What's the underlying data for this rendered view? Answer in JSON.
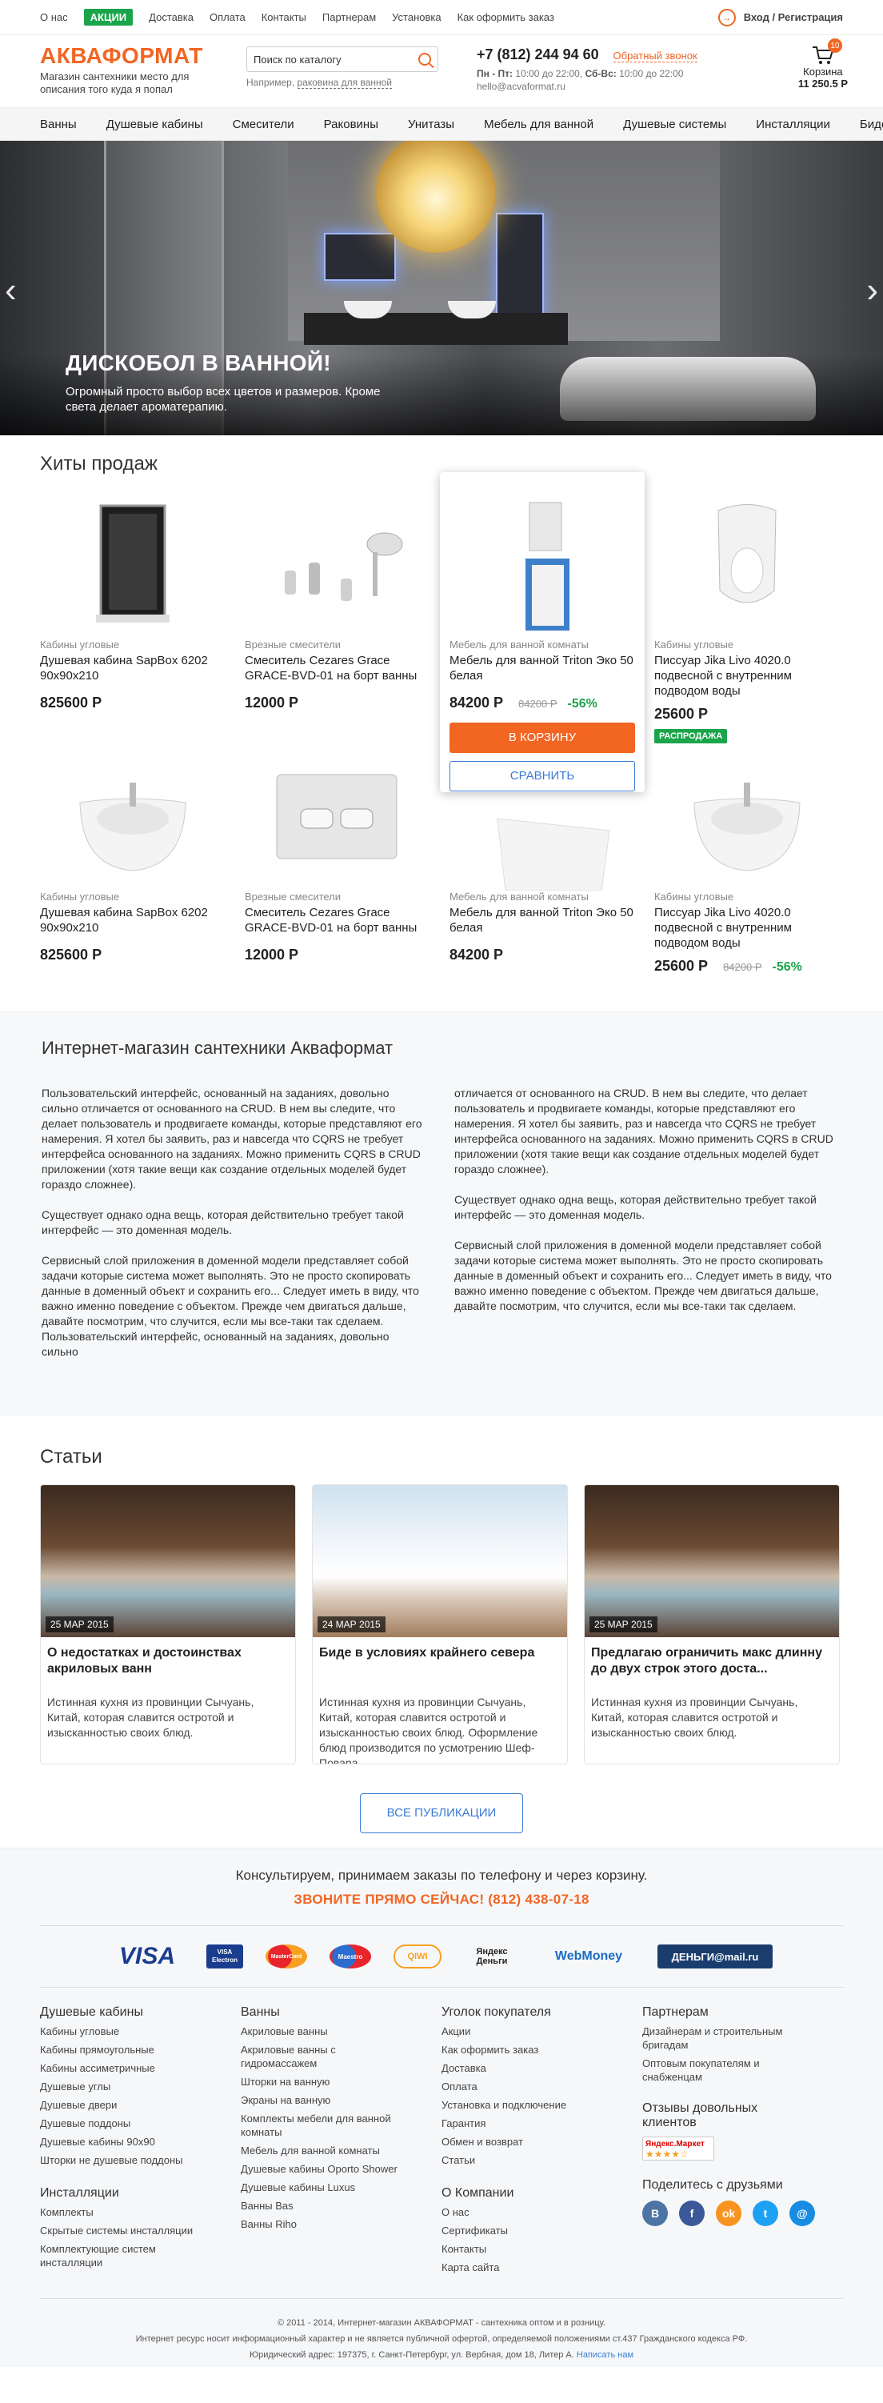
{
  "topbar": {
    "links": [
      "О нас",
      "Доставка",
      "Оплата",
      "Контакты",
      "Партнерам",
      "Установка",
      "Как оформить заказ"
    ],
    "promo": "АКЦИИ",
    "login": "Вход / Регистрация"
  },
  "header": {
    "logo": "АКВАФОРМАТ",
    "tagline": "Магазин сантехники место для описания того куда я попал",
    "search_placeholder": "Поиск по каталогу",
    "search_hint_prefix": "Например,",
    "search_hint_link": "раковина для ванной",
    "phone": "+7 (812) 244 94 60",
    "callback": "Обратный звонок",
    "hours_wd_label": "Пн - Пт:",
    "hours_wd": "10:00 до 22:00,",
    "hours_we_label": "Сб-Вс:",
    "hours_we": "10:00 до 22:00",
    "email": "hello@acvaformat.ru",
    "cart_label": "Корзина",
    "cart_sum": "11 250.5 Р",
    "cart_count": "10"
  },
  "nav": [
    "Ванны",
    "Душевые кабины",
    "Смесители",
    "Раковины",
    "Унитазы",
    "Мебель для ванной",
    "Душевые системы",
    "Инсталляции",
    "Биде"
  ],
  "hero": {
    "title": "ДИСКОБОЛ В ВАННОЙ!",
    "text": "Огромный просто выбор всех цветов и размеров. Кроме света делает ароматерапию."
  },
  "hits": {
    "title": "Хиты продаж",
    "cart_btn": "В КОРЗИНУ",
    "compare_btn": "СРАВНИТЬ",
    "sale_badge": "РАСПРОДАЖА",
    "products": [
      {
        "cat": "Кабины угловые",
        "name": "Душевая кабина SapBox 6202 90x90x210",
        "price": "825600 Р"
      },
      {
        "cat": "Врезные смесители",
        "name": "Смеситель Cezares Grace GRACE-BVD-01 на борт ванны",
        "price": "12000 Р"
      },
      {
        "cat": "Мебель для ванной комнаты",
        "name": "Мебель для ванной Triton Эко 50 белая",
        "price": "84200 Р",
        "old": "84200 Р",
        "disc": "-56%"
      },
      {
        "cat": "Кабины угловые",
        "name": "Писсуар Jika Livo 4020.0 подвесной с внутренним подводом воды",
        "price": "25600 Р"
      },
      {
        "cat": "Кабины угловые",
        "name": "Душевая кабина SapBox 6202 90x90x210",
        "price": "825600 Р"
      },
      {
        "cat": "Врезные смесители",
        "name": "Смеситель Cezares Grace GRACE-BVD-01 на борт ванны",
        "price": "12000 Р"
      },
      {
        "cat": "Мебель для ванной комнаты",
        "name": "Мебель для ванной Triton Эко 50 белая",
        "price": "84200 Р"
      },
      {
        "cat": "Кабины угловые",
        "name": "Писсуар Jika Livo 4020.0 подвесной с внутренним подводом воды",
        "price": "25600 Р",
        "old": "84200 Р",
        "disc": "-56%"
      }
    ]
  },
  "about": {
    "title": "Интернет-магазин сантехники Аквaформат",
    "col1": [
      "Пользовательский интерфейс, основанный на заданиях, довольно сильно отличается от основанного на CRUD. В нем вы следите, что делает пользователь и продвигаете команды, которые представляют его намерения. Я хотел бы заявить, раз и навсегда что CQRS не требует интерфейса основанного на заданиях. Можно применить CQRS в CRUD приложении (хотя такие вещи как создание отдельных моделей будет гораздо сложнее).",
      "Существует однако одна вещь, которая действительно требует такой интерфейс — это доменная модель.",
      "Сервисный слой приложения в доменной модели представляет собой задачи которые система может выполнять. Это не просто скопировать данные в доменный объект и сохранить его... Следует иметь в виду, что важно именно поведение с объектом. Прежде чем двигаться дальше, давайте посмотрим, что случится, если мы все-таки так сделаем. Пользовательский интерфейс, основанный на заданиях, довольно сильно"
    ],
    "col2": [
      "отличается от основанного на CRUD. В нем вы следите, что делает пользователь и продвигаете команды, которые представляют его намерения. Я хотел бы заявить, раз и навсегда что CQRS не требует интерфейса основанного на заданиях. Можно применить CQRS в CRUD приложении (хотя такие вещи как создание отдельных моделей будет гораздо сложнее).",
      "Существует однако одна вещь, которая действительно требует такой интерфейс — это доменная модель.",
      "Сервисный слой приложения в доменной модели представляет собой задачи которые система может выполнять. Это не просто скопировать данные в доменный объект и сохранить его... Следует иметь в виду, что важно именно поведение с объектом. Прежде чем двигаться дальше, давайте посмотрим, что случится, если мы все-таки так сделаем."
    ]
  },
  "articles": {
    "title": "Статьи",
    "all_btn": "ВСЕ ПУБЛИКАЦИИ",
    "items": [
      {
        "date": "25 МАР 2015",
        "title": "О недостатках и достоинствах акриловых ванн",
        "text": "Истинная кухня из провинции Сычуань, Китай, которая славится остротой и изысканностью своих блюд."
      },
      {
        "date": "24 МАР 2015",
        "title": "Биде в условиях крайнего севера",
        "text": "Истинная кухня из провинции Сычуань, Китай, которая славится остротой и изысканностью своих блюд. Оформление блюд производится по усмотрению Шеф-Повара."
      },
      {
        "date": "25 МАР 2015",
        "title": "Предлагаю ограничить макс длинну до двух строк этого доста...",
        "text": "Истинная кухня из провинции Сычуань, Китай, которая славится остротой и изысканностью своих блюд."
      }
    ]
  },
  "footer": {
    "consult": "Консультируем, принимаем заказы по телефону и через корзину.",
    "call": "ЗВОНИТЕ ПРЯМО СЕЙЧАС! (812) 438-07-18",
    "payments": [
      "VISA",
      "VISA Electron",
      "MasterCard",
      "Maestro",
      "QIWI",
      "Яндекс Деньги",
      "WebMoney",
      "ДЕНЬГИ@mail.ru"
    ],
    "col1": {
      "title": "Душевые кабины",
      "items": [
        "Кабины угловые",
        "Кабины прямоугольные",
        "Кабины ассиметричные",
        "Душевые углы",
        "Душевые двери",
        "Душевые поддоны",
        "Душевые кабины 90x90",
        "Шторки не душевые поддоны"
      ]
    },
    "col1b": {
      "title": "Инсталляции",
      "items": [
        "Комплекты",
        "Скрытые системы инсталляции",
        "Комплектующие систем инсталляции"
      ]
    },
    "col2": {
      "title": "Ванны",
      "items": [
        "Акриловые ванны",
        "Акриловые ванны с гидромассажем",
        "Шторки на ванную",
        "Экраны на ванную",
        "Комплекты мебели для ванной комнаты",
        "Мебель для ванной комнаты",
        "Душевые кабины Oporto Shower",
        "Душевые кабины Luxus",
        "Ванны Bas",
        "Ванны Riho"
      ]
    },
    "col3": {
      "title": "Уголок покупателя",
      "items": [
        "Акции",
        "Как оформить заказ",
        "Доставка",
        "Оплата",
        "Установка и подключение",
        "Гарантия",
        "Обмен и возврат",
        "Статьи"
      ]
    },
    "col3b": {
      "title": "О Компании",
      "items": [
        "О нас",
        "Сертификаты",
        "Контакты",
        "Карта сайта"
      ]
    },
    "col4": {
      "title": "Партнерам",
      "items": [
        "Дизайнерам и строительным бригадам",
        "Оптовым покупателям и снабженцам"
      ]
    },
    "reviews_title": "Отзывы довольных клиентов",
    "yandex_badge": "Яндекс.Маркет",
    "share_title": "Поделитесь с друзьями",
    "socials": [
      "vk",
      "facebook",
      "odnoklassniki",
      "twitter",
      "mail"
    ],
    "copy1": "© 2011 - 2014, Интернет-магазин АКВАФОРМАТ - сантехника оптом и в розницу.",
    "copy2": "Интернет ресурс носит информационный характер и не является публичной офертой, определяемой положениями ст.437 Гражданского кодекса РФ.",
    "copy3": "Юридический адрес: 197375, г. Санкт-Петербург, ул. Вербная, дом 18, Литер А.",
    "write": "Написать нам"
  },
  "colors": {
    "accent": "#f26522",
    "green": "#1aa54a",
    "blue": "#3a7bd5"
  }
}
